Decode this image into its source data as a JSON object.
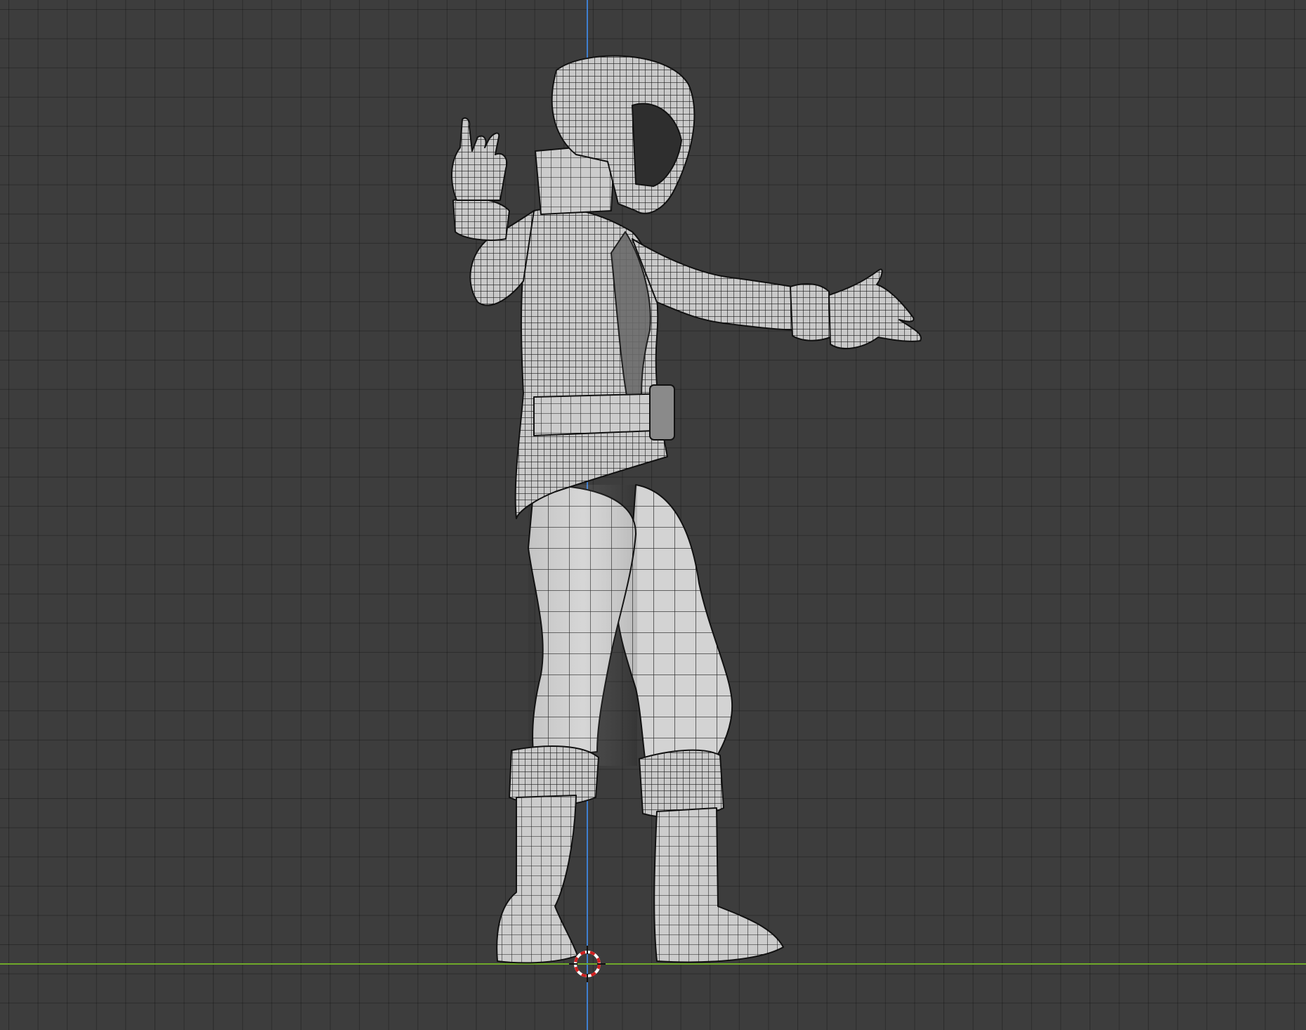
{
  "viewport": {
    "background_color": "#3d3d3d",
    "grid_color": "#2b2b2b",
    "x_axis_color": "#6fa82a",
    "z_axis_color": "#3f7fd0",
    "cursor_colors": [
      "#d02020",
      "#ffffff"
    ],
    "mesh_fill": "#cfcfcf",
    "mesh_wire": "#111111"
  },
  "scene": {
    "object": "character-mesh",
    "mode": "solid-wireframe"
  }
}
